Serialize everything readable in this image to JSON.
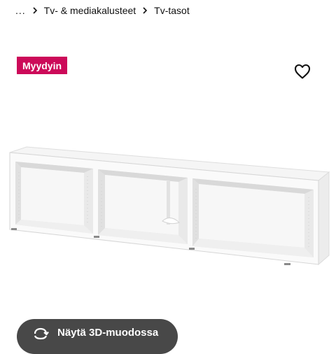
{
  "breadcrumb": {
    "ellipsis": "...",
    "items": [
      {
        "label": "Tv- & mediakalusteet"
      },
      {
        "label": "Tv-tasot"
      }
    ]
  },
  "badge": {
    "label": "Myydyin",
    "color": "#cc0a59"
  },
  "favorite": {
    "icon": "heart-outline-icon"
  },
  "product_image": {
    "description_icon": "tv-bench-image"
  },
  "view_3d": {
    "label": "Näytä 3D-muodossa",
    "icon": "rotate-3d-icon",
    "color": "#484848"
  }
}
